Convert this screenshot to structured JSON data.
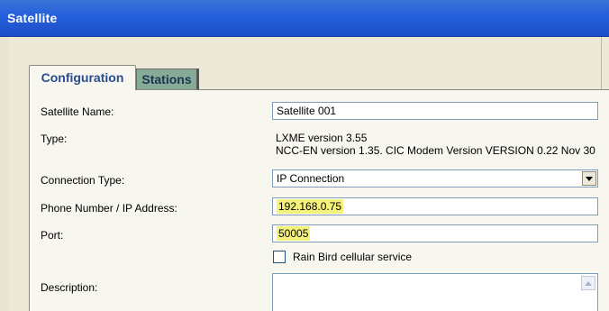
{
  "window": {
    "title": "Satellite"
  },
  "tabs": [
    {
      "label": "Configuration",
      "active": true
    },
    {
      "label": "Stations",
      "active": false
    }
  ],
  "form": {
    "satellite_name": {
      "label": "Satellite Name:",
      "value": "Satellite 001"
    },
    "type": {
      "label": "Type:",
      "line1": "LXME version 3.55",
      "line2": "NCC-EN version 1.35. CIC Modem Version VERSION 0.22 Nov 30"
    },
    "connection_type": {
      "label": "Connection Type:",
      "value": "IP Connection"
    },
    "address": {
      "label": "Phone Number / IP Address:",
      "value": "192.168.0.75"
    },
    "port": {
      "label": "Port:",
      "value": "50005"
    },
    "cellular": {
      "label": "Rain Bird cellular service",
      "checked": false
    },
    "description": {
      "label": "Description:",
      "value": ""
    }
  },
  "colors": {
    "titlebar": "#245edb",
    "highlight": "#f4f27a",
    "active_tab_text": "#2a4c8f",
    "inactive_tab_bg": "#86ac98"
  }
}
